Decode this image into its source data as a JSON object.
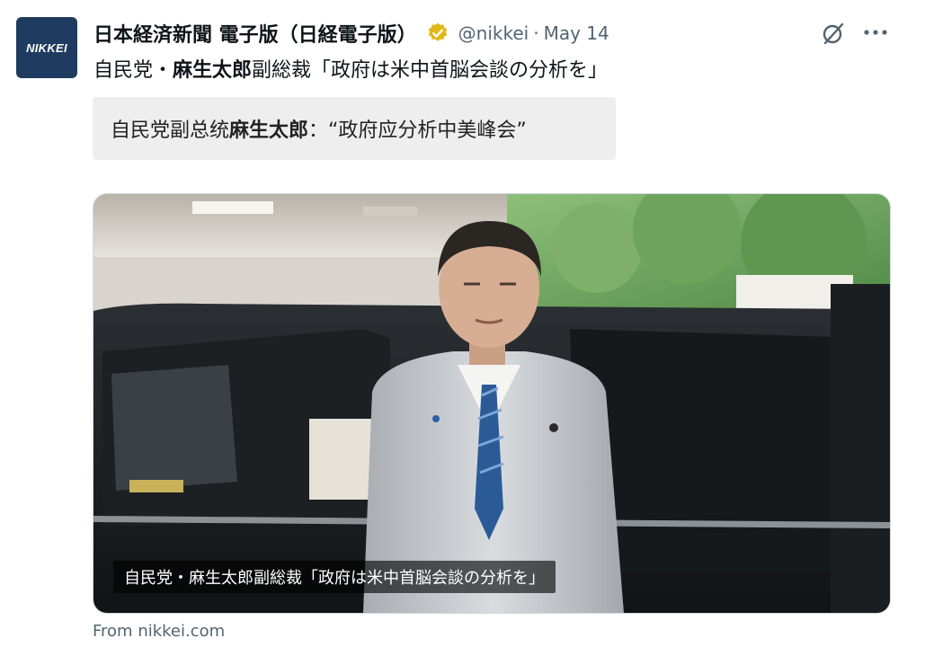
{
  "author": {
    "avatar_text": "NIKKEI",
    "name": "日本経済新聞 電子版（日経電子版）",
    "handle": "@nikkei",
    "separator": "·",
    "date": "May 14"
  },
  "icons": {
    "verified": "verified-badge-icon",
    "grok": "grok-icon",
    "more": "more-options-icon"
  },
  "tweet": {
    "text_pre": "自民党・",
    "text_bold": "麻生太郎",
    "text_post": "副総裁「政府は米中首脳会談の分析を」"
  },
  "translation": {
    "text_pre": "自民党副总统",
    "text_bold": "麻生太郎",
    "text_post": "：“政府应分析中美峰会”"
  },
  "card": {
    "caption": "自民党・麻生太郎副総裁「政府は米中首脳会談の分析を」",
    "source": "From nikkei.com"
  },
  "colors": {
    "brand_navy": "#1f3c60",
    "verified_gold": "#e2b719",
    "secondary_text": "#536471"
  }
}
